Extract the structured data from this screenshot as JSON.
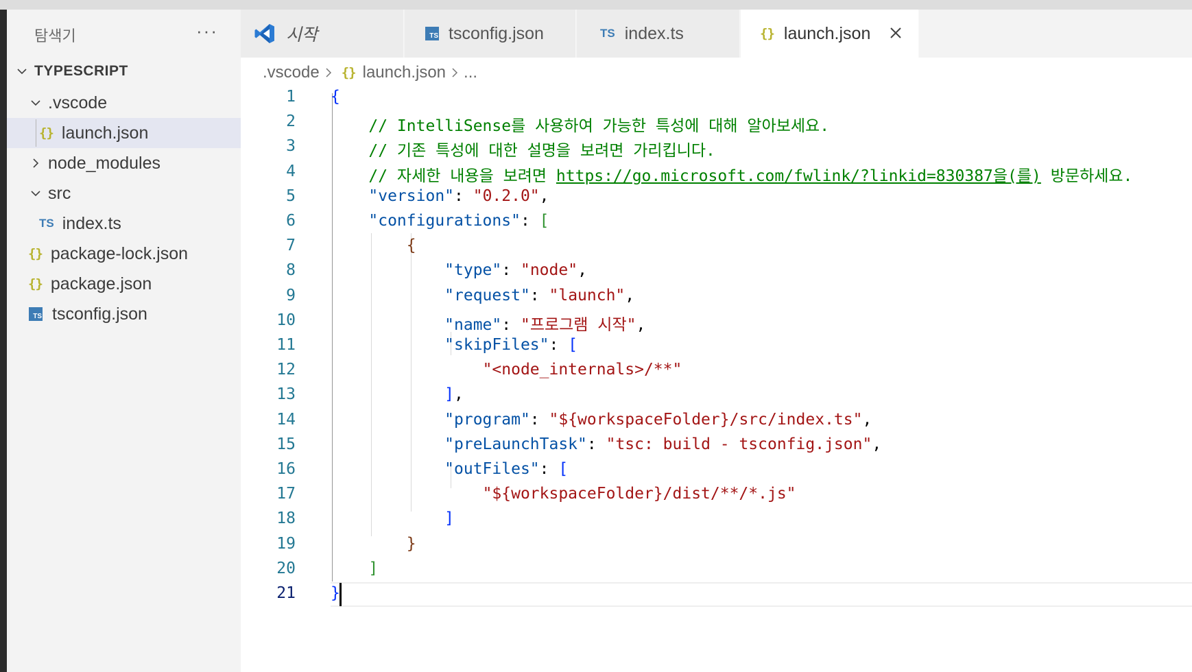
{
  "explorer": {
    "title": "탐색기",
    "more_icon": "ellipsis-icon",
    "root_label": "TYPESCRIPT",
    "items": [
      {
        "label": ".vscode",
        "icon": "chevron-down-icon"
      },
      {
        "label": "launch.json",
        "icon": "json-braces-icon"
      },
      {
        "label": "node_modules",
        "icon": "chevron-right-icon"
      },
      {
        "label": "src",
        "icon": "chevron-down-icon"
      },
      {
        "label": "index.ts",
        "icon": "typescript-icon"
      },
      {
        "label": "package-lock.json",
        "icon": "json-braces-icon"
      },
      {
        "label": "package.json",
        "icon": "json-braces-icon"
      },
      {
        "label": "tsconfig.json",
        "icon": "tsconfig-icon"
      }
    ]
  },
  "tabs": [
    {
      "label": "시작",
      "icon": "vscode-logo-icon"
    },
    {
      "label": "tsconfig.json",
      "icon": "tsconfig-icon"
    },
    {
      "label": "index.ts",
      "icon": "typescript-icon"
    },
    {
      "label": "launch.json",
      "icon": "json-braces-icon",
      "active": true
    }
  ],
  "icon_text": {
    "braces": "{}",
    "ts": "TS",
    "ts_box": "TS"
  },
  "breadcrumb": {
    "items": [
      ".vscode",
      "launch.json",
      "..."
    ]
  },
  "editor": {
    "current_line": 21,
    "line_numbers": [
      "1",
      "2",
      "3",
      "4",
      "5",
      "6",
      "7",
      "8",
      "9",
      "10",
      "11",
      "12",
      "13",
      "14",
      "15",
      "16",
      "17",
      "18",
      "19",
      "20",
      "21"
    ],
    "lines": [
      [
        [
          "{",
          "br-blue"
        ]
      ],
      [
        [
          "    // IntelliSense를 사용하여 가능한 특성에 대해 알아보세요.",
          "comment"
        ]
      ],
      [
        [
          "    // 기존 특성에 대한 설명을 보려면 가리킵니다.",
          "comment"
        ]
      ],
      [
        [
          "    // 자세한 내용을 보려면 ",
          "comment"
        ],
        [
          "https://go.microsoft.com/fwlink/?linkid=830387을(를)",
          "link"
        ],
        [
          " 방문하세요.",
          "comment"
        ]
      ],
      [
        [
          "    ",
          "plain"
        ],
        [
          "\"version\"",
          "key"
        ],
        [
          ": ",
          "plain"
        ],
        [
          "\"0.2.0\"",
          "str"
        ],
        [
          ",",
          "plain"
        ]
      ],
      [
        [
          "    ",
          "plain"
        ],
        [
          "\"configurations\"",
          "key"
        ],
        [
          ": ",
          "plain"
        ],
        [
          "[",
          "br-green"
        ]
      ],
      [
        [
          "        ",
          "plain"
        ],
        [
          "{",
          "br-brown"
        ]
      ],
      [
        [
          "            ",
          "plain"
        ],
        [
          "\"type\"",
          "key"
        ],
        [
          ": ",
          "plain"
        ],
        [
          "\"node\"",
          "str"
        ],
        [
          ",",
          "plain"
        ]
      ],
      [
        [
          "            ",
          "plain"
        ],
        [
          "\"request\"",
          "key"
        ],
        [
          ": ",
          "plain"
        ],
        [
          "\"launch\"",
          "str"
        ],
        [
          ",",
          "plain"
        ]
      ],
      [
        [
          "            ",
          "plain"
        ],
        [
          "\"name\"",
          "key"
        ],
        [
          ": ",
          "plain"
        ],
        [
          "\"프로그램 시작\"",
          "str"
        ],
        [
          ",",
          "plain"
        ]
      ],
      [
        [
          "            ",
          "plain"
        ],
        [
          "\"skipFiles\"",
          "key"
        ],
        [
          ": ",
          "plain"
        ],
        [
          "[",
          "br-blue"
        ]
      ],
      [
        [
          "                ",
          "plain"
        ],
        [
          "\"<node_internals>/**\"",
          "str"
        ]
      ],
      [
        [
          "            ",
          "plain"
        ],
        [
          "]",
          "br-blue"
        ],
        [
          ",",
          "plain"
        ]
      ],
      [
        [
          "            ",
          "plain"
        ],
        [
          "\"program\"",
          "key"
        ],
        [
          ": ",
          "plain"
        ],
        [
          "\"${workspaceFolder}/src/index.ts\"",
          "str"
        ],
        [
          ",",
          "plain"
        ]
      ],
      [
        [
          "            ",
          "plain"
        ],
        [
          "\"preLaunchTask\"",
          "key"
        ],
        [
          ": ",
          "plain"
        ],
        [
          "\"tsc: build - tsconfig.json\"",
          "str"
        ],
        [
          ",",
          "plain"
        ]
      ],
      [
        [
          "            ",
          "plain"
        ],
        [
          "\"outFiles\"",
          "key"
        ],
        [
          ": ",
          "plain"
        ],
        [
          "[",
          "br-blue"
        ]
      ],
      [
        [
          "                ",
          "plain"
        ],
        [
          "\"${workspaceFolder}/dist/**/*.js\"",
          "str"
        ]
      ],
      [
        [
          "            ",
          "plain"
        ],
        [
          "]",
          "br-blue"
        ]
      ],
      [
        [
          "        ",
          "plain"
        ],
        [
          "}",
          "br-brown"
        ]
      ],
      [
        [
          "    ",
          "plain"
        ],
        [
          "]",
          "br-green"
        ]
      ],
      [
        [
          "}",
          "br-blue"
        ]
      ]
    ]
  },
  "colors": {
    "comment": "#008000",
    "key": "#0451a5",
    "string": "#a31515",
    "bracket_blue": "#0431fa",
    "bracket_green": "#319331",
    "bracket_brown": "#7b3814",
    "line_number": "#237893",
    "accent": "#007acc"
  }
}
